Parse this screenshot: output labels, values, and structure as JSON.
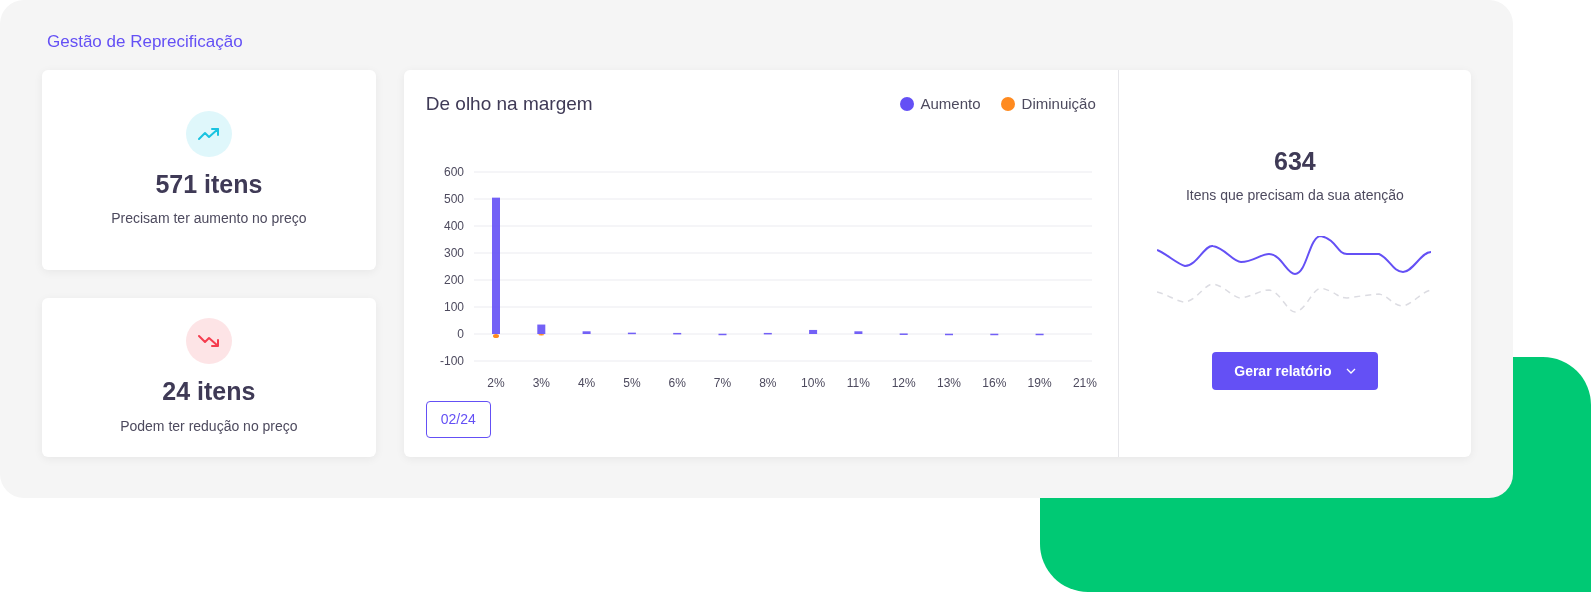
{
  "section_title": "Gestão de Reprecificação",
  "summary_cards": [
    {
      "kind": "increase",
      "value": "571 itens",
      "caption": "Precisam ter aumento no preço"
    },
    {
      "kind": "decrease",
      "value": "24 itens",
      "caption": "Podem ter redução no preço"
    }
  ],
  "margin_chart": {
    "title": "De olho na margem",
    "period_button": "02/24",
    "chart_data": {
      "type": "bar",
      "categories": [
        "2%",
        "3%",
        "4%",
        "5%",
        "6%",
        "7%",
        "8%",
        "10%",
        "11%",
        "12%",
        "13%",
        "16%",
        "19%",
        "21%"
      ],
      "series": [
        {
          "name": "Aumento",
          "color": "#6450f5",
          "values": [
            505,
            35,
            10,
            5,
            4,
            1,
            4,
            15,
            10,
            2,
            1,
            1,
            1,
            0
          ]
        },
        {
          "name": "Diminuição",
          "color": "#ff8a1f",
          "values": [
            -15,
            -2,
            0,
            0,
            0,
            0,
            0,
            0,
            0,
            0,
            0,
            0,
            0,
            0
          ]
        }
      ],
      "ylim": [
        -100,
        600
      ],
      "grid": true,
      "yticks": [
        -100,
        0,
        100,
        200,
        300,
        400,
        500,
        600
      ]
    }
  },
  "attention": {
    "value": "634",
    "caption": "Itens que precisam da sua atenção",
    "button": "Gerar relatório"
  }
}
